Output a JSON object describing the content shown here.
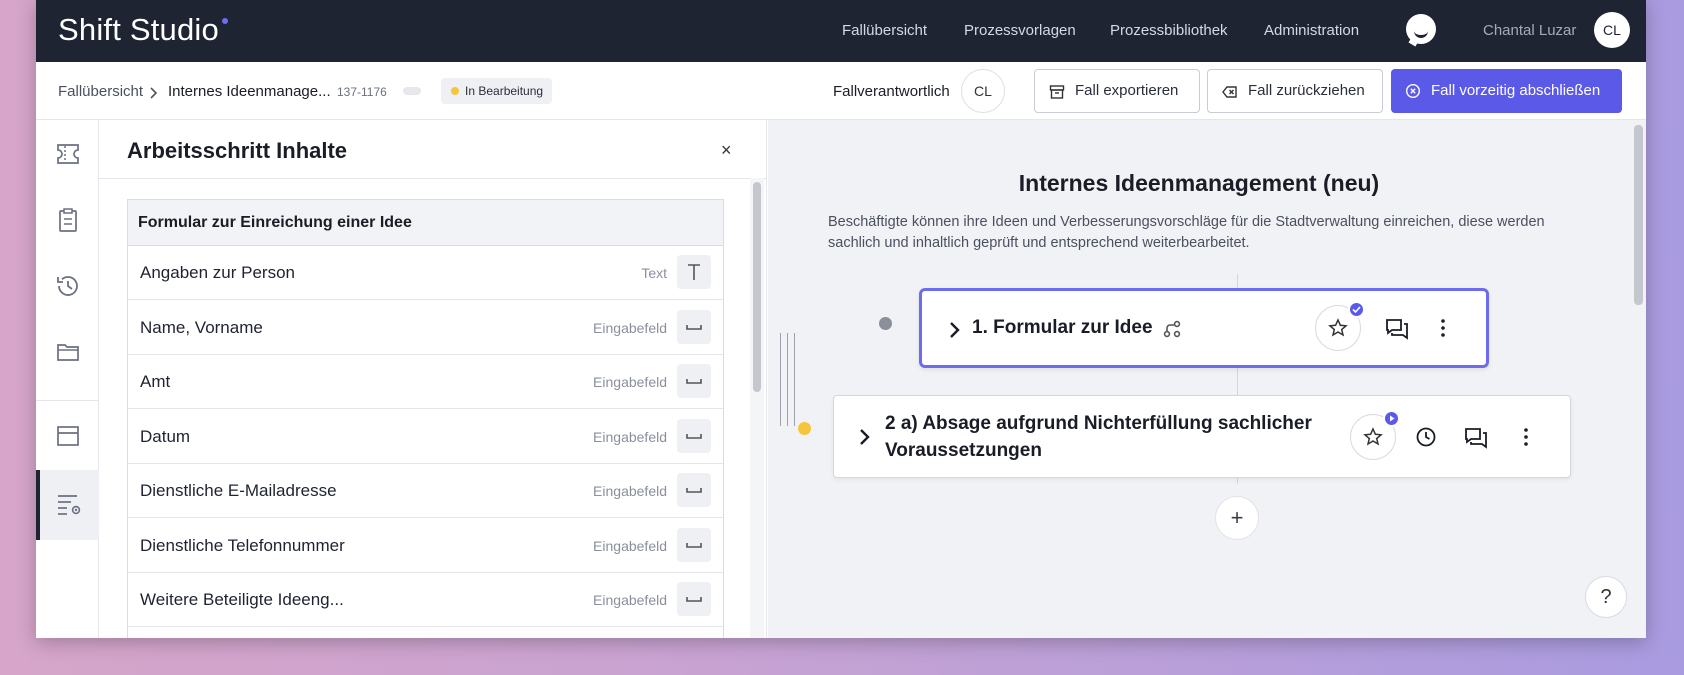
{
  "topbar": {
    "brand": "Shift Studio",
    "nav": [
      "Fallübersicht",
      "Prozessvorlagen",
      "Prozessbibliothek",
      "Administration"
    ],
    "user_name": "Chantal Luzar",
    "user_initials": "CL",
    "chat_icon": "chat-bubble-icon"
  },
  "subbar": {
    "breadcrumb_root": "Fallübersicht",
    "breadcrumb_current": "Internes Ideenmanage...",
    "case_id": "137-1176",
    "status": "In Bearbeitung",
    "owner_label": "Fallverantwortlich",
    "owner_initials": "CL",
    "export_label": "Fall exportieren",
    "withdraw_label": "Fall zurückziehen",
    "close_label": "Fall vorzeitig abschließen"
  },
  "rail": {
    "items": [
      "ticket-icon",
      "clipboard-icon",
      "history-icon",
      "folder-icon",
      "card-icon",
      "list-settings-icon"
    ],
    "active_index": 5
  },
  "panel": {
    "title": "Arbeitsschritt Inhalte",
    "close": "×",
    "table_header": "Formular zur Einreichung einer Idee",
    "rows": [
      {
        "label": "Angaben zur Person",
        "type": "Text",
        "icon": "text-icon"
      },
      {
        "label": "Name, Vorname",
        "type": "Eingabefeld",
        "icon": "input-field-icon"
      },
      {
        "label": "Amt",
        "type": "Eingabefeld",
        "icon": "input-field-icon"
      },
      {
        "label": "Datum",
        "type": "Eingabefeld",
        "icon": "input-field-icon"
      },
      {
        "label": "Dienstliche E-Mailadresse",
        "type": "Eingabefeld",
        "icon": "input-field-icon"
      },
      {
        "label": "Dienstliche Telefonnummer",
        "type": "Eingabefeld",
        "icon": "input-field-icon"
      },
      {
        "label": "Weitere Beteiligte Ideeng...",
        "type": "Eingabefeld",
        "icon": "input-field-icon"
      }
    ]
  },
  "canvas": {
    "title": "Internes Ideenmanagement (neu)",
    "description": "Beschäftigte können ihre Ideen und Verbesserungsvorschläge für die Stadtverwaltung einreichen, diese werden sachlich und inhaltlich geprüft und entsprechend weiterbearbeitet.",
    "step1_title": "1. Formular zur Idee",
    "step2_title_line1": "2 a) Absage aufgrund Nichterfüllung sachlicher",
    "step2_title_line2": "Voraussetzungen",
    "add": "+",
    "help": "?"
  },
  "colors": {
    "accent": "#5a59e8",
    "topbar": "#1f2432",
    "status_yellow": "#f5c53b"
  }
}
